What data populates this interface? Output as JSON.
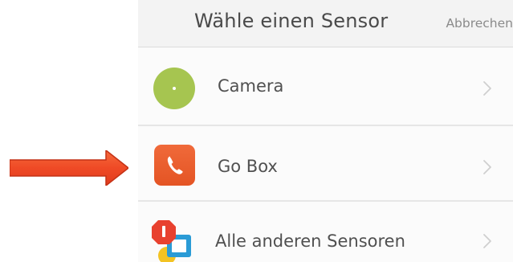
{
  "header": {
    "title": "Wähle einen Sensor",
    "cancel_label": "Abbrechen"
  },
  "sensors": [
    {
      "label": "Camera",
      "icon": "camera-icon"
    },
    {
      "label": "Go Box",
      "icon": "phone-icon"
    },
    {
      "label": "Alle anderen Sensoren",
      "icon": "sensor-shapes-icon"
    }
  ],
  "colors": {
    "arrow": "#f04e2a",
    "camera": "#a6c550",
    "gobox": "#e8582a",
    "octagon": "#e8412f",
    "square": "#2a9bd6",
    "yellow": "#f3c323"
  }
}
